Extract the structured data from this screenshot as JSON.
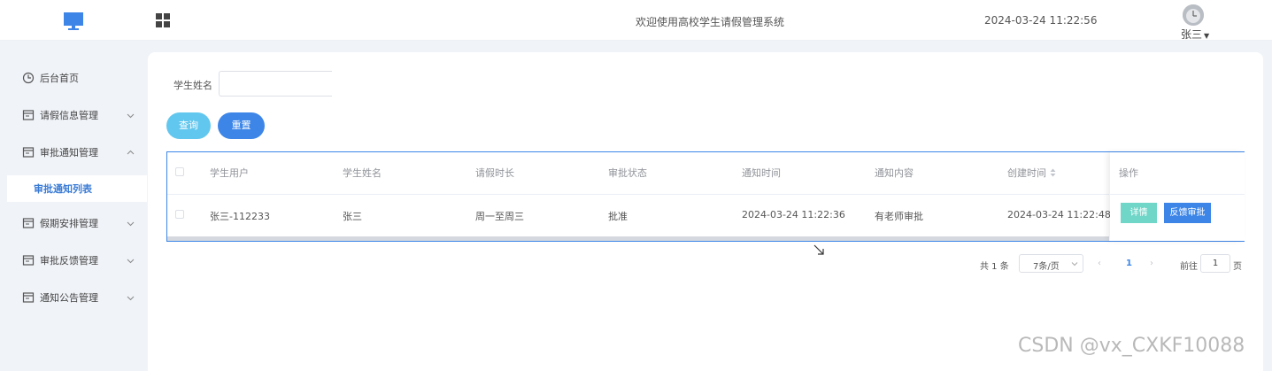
{
  "header": {
    "title": "欢迎使用高校学生请假管理系统",
    "datetime": "2024-03-24 11:22:56",
    "user_name": "张三",
    "icons": [
      "monitor-icon",
      "grid-icon",
      "avatar",
      "caret-down-icon"
    ]
  },
  "sidebar": {
    "items": [
      {
        "label": "后台首页",
        "icon": "clock-icon",
        "expandable": false
      },
      {
        "label": "请假信息管理",
        "icon": "window-icon",
        "expandable": true,
        "expanded": false
      },
      {
        "label": "审批通知管理",
        "icon": "window-icon",
        "expandable": true,
        "expanded": true
      },
      {
        "label": "假期安排管理",
        "icon": "window-icon",
        "expandable": true,
        "expanded": false
      },
      {
        "label": "审批反馈管理",
        "icon": "window-icon",
        "expandable": true,
        "expanded": false
      },
      {
        "label": "通知公告管理",
        "icon": "window-icon",
        "expandable": true,
        "expanded": false
      }
    ],
    "active_sub_item": "审批通知列表"
  },
  "search": {
    "label": "学生姓名",
    "value": "",
    "query_label": "查询",
    "reset_label": "重置"
  },
  "table": {
    "columns": [
      "学生用户",
      "学生姓名",
      "请假时长",
      "审批状态",
      "通知时间",
      "通知内容",
      "创建时间",
      "操作"
    ],
    "rows": [
      {
        "student_user": "张三-112233",
        "student_name": "张三",
        "leave_duration": "周一至周三",
        "approval_status": "批准",
        "notify_time": "2024-03-24 11:22:36",
        "notify_content": "有老师审批",
        "created_time": "2024-03-24 11:22:48",
        "detail_label": "详情",
        "feedback_label": "反馈审批"
      }
    ]
  },
  "pagination": {
    "total_text": "共 1 条",
    "page_size_text": "7条/页",
    "current_page": "1",
    "goto_label": "前往",
    "goto_value": "1",
    "page_suffix": "页"
  },
  "watermark": "CSDN @vx_CXKF10088",
  "colors": {
    "primary": "#3d86e8",
    "query_button": "#62c7ee",
    "detail_button": "#6fd6c8",
    "background": "#f0f3f8"
  }
}
